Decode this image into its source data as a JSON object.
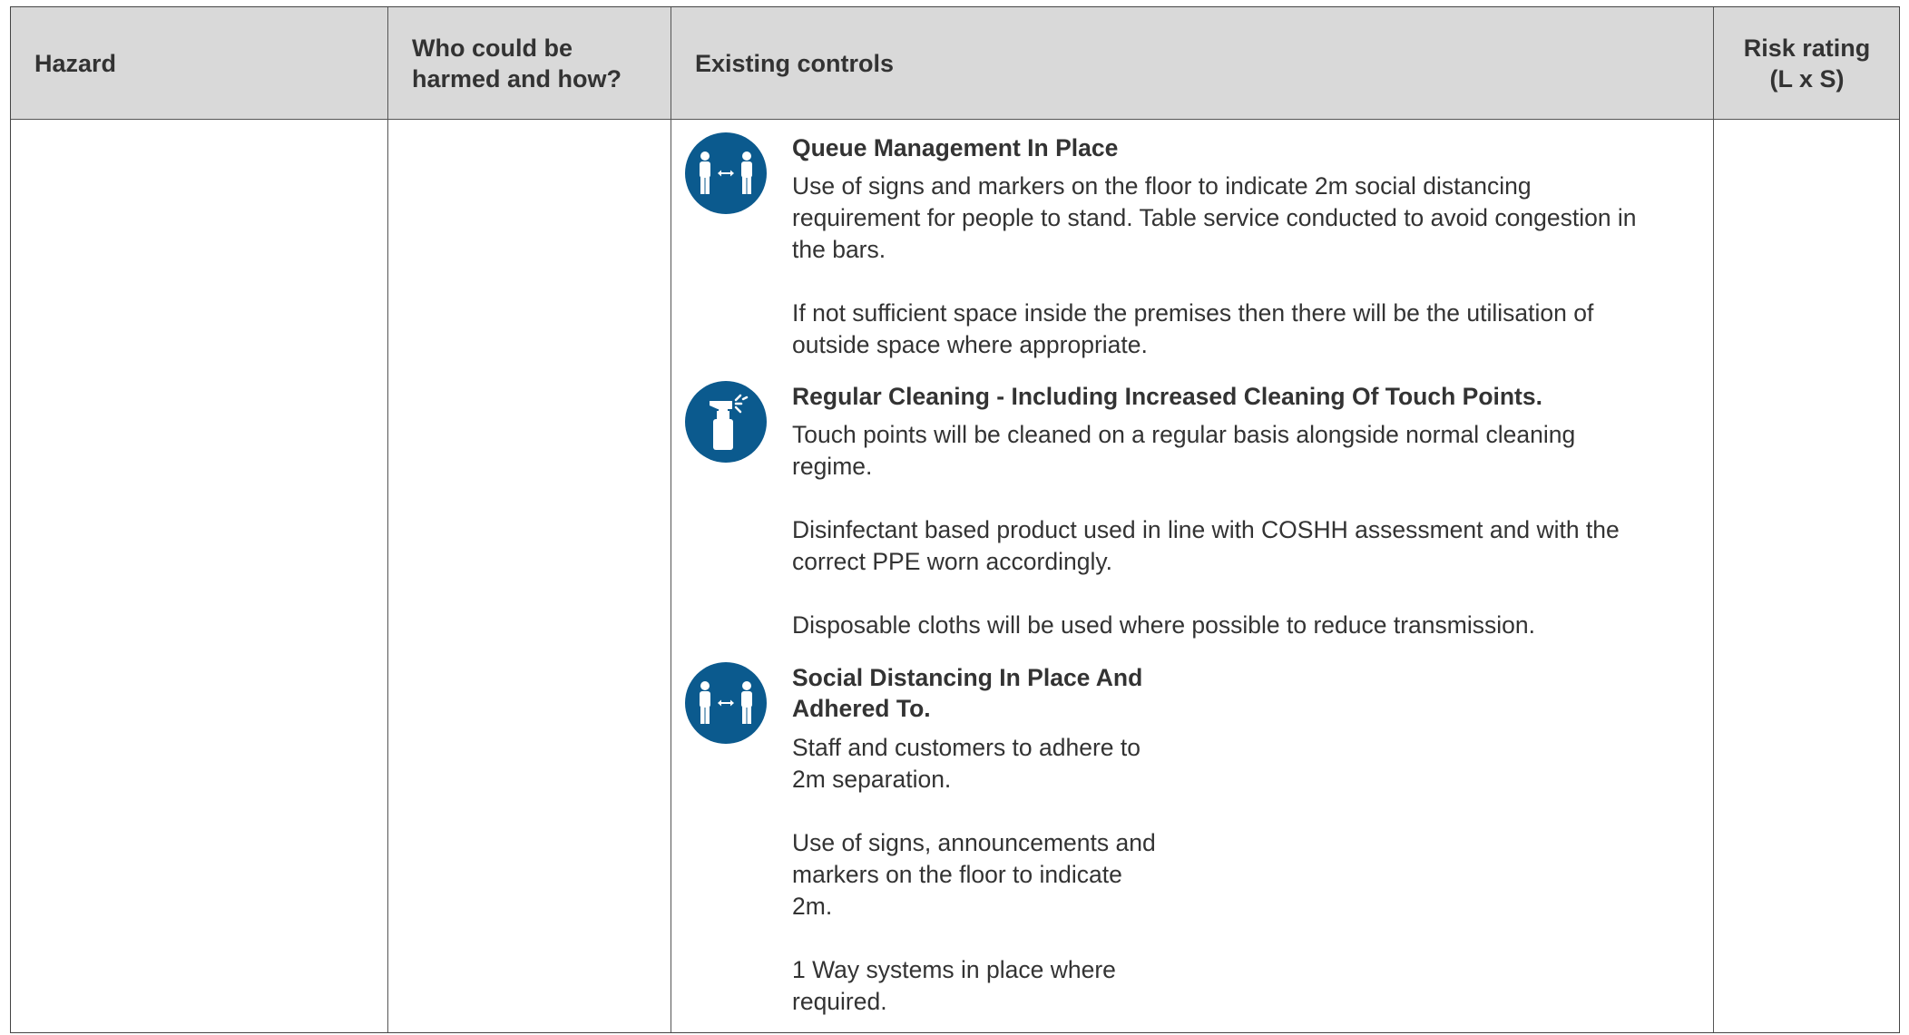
{
  "headers": {
    "hazard": "Hazard",
    "who_line1": "Who could be",
    "who_line2": "harmed and how?",
    "controls": "Existing controls",
    "risk_line1": "Risk rating",
    "risk_line2": "(L x S)"
  },
  "controls": [
    {
      "icon": "social-distancing-icon",
      "title": "Queue Management In Place",
      "paragraphs": [
        [
          "Use of signs and markers on the floor to indicate 2m social distancing",
          "requirement for people to stand. Table service conducted to avoid congestion in",
          "the bars."
        ],
        [
          "If not sufficient space inside the premises then there will be the utilisation of",
          "outside space where appropriate."
        ]
      ]
    },
    {
      "icon": "spray-bottle-icon",
      "title": "Regular Cleaning - Including Increased Cleaning Of Touch Points.",
      "paragraphs": [
        [
          "Touch points will be cleaned on a regular basis alongside normal cleaning",
          "regime."
        ],
        [
          "Disinfectant based product used in line with COSHH assessment and with the",
          "correct PPE worn accordingly."
        ],
        [
          "Disposable cloths will be used where possible to reduce transmission."
        ]
      ]
    },
    {
      "icon": "social-distancing-icon",
      "title_lines": [
        "Social Distancing In Place And",
        "Adhered To."
      ],
      "paragraphs": [
        [
          "Staff and customers to adhere to",
          "2m separation."
        ],
        [
          "Use of signs, announcements and",
          "markers on the floor to indicate",
          "2m."
        ],
        [
          "1 Way systems in place where",
          "required."
        ]
      ]
    }
  ],
  "colors": {
    "icon_blue": "#0b5a8e",
    "header_bg": "#d9d9d9"
  }
}
